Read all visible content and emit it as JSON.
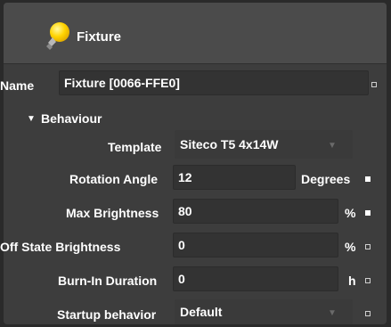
{
  "header": {
    "title": "Fixture",
    "icon": "lightbulb-icon"
  },
  "name": {
    "label": "Name",
    "value": "Fixture [0066-FFE0]"
  },
  "behaviour": {
    "label": "Behaviour"
  },
  "template": {
    "label": "Template",
    "value": "Siteco T5 4x14W"
  },
  "rotation_angle": {
    "label": "Rotation Angle",
    "value": "12",
    "unit": "Degrees"
  },
  "max_brightness": {
    "label": "Max Brightness",
    "value": "80",
    "unit": "%"
  },
  "off_state_brightness": {
    "label": "Off State Brightness",
    "value": "0",
    "unit": "%"
  },
  "burn_in_duration": {
    "label": "Burn-In Duration",
    "value": "0",
    "unit": "h"
  },
  "startup_behavior": {
    "label": "Startup behavior",
    "value": "Default"
  },
  "colors": {
    "background": "#3d3d3d",
    "header": "#4b4b4b",
    "field": "#333333",
    "bulb": "#ffd400"
  }
}
